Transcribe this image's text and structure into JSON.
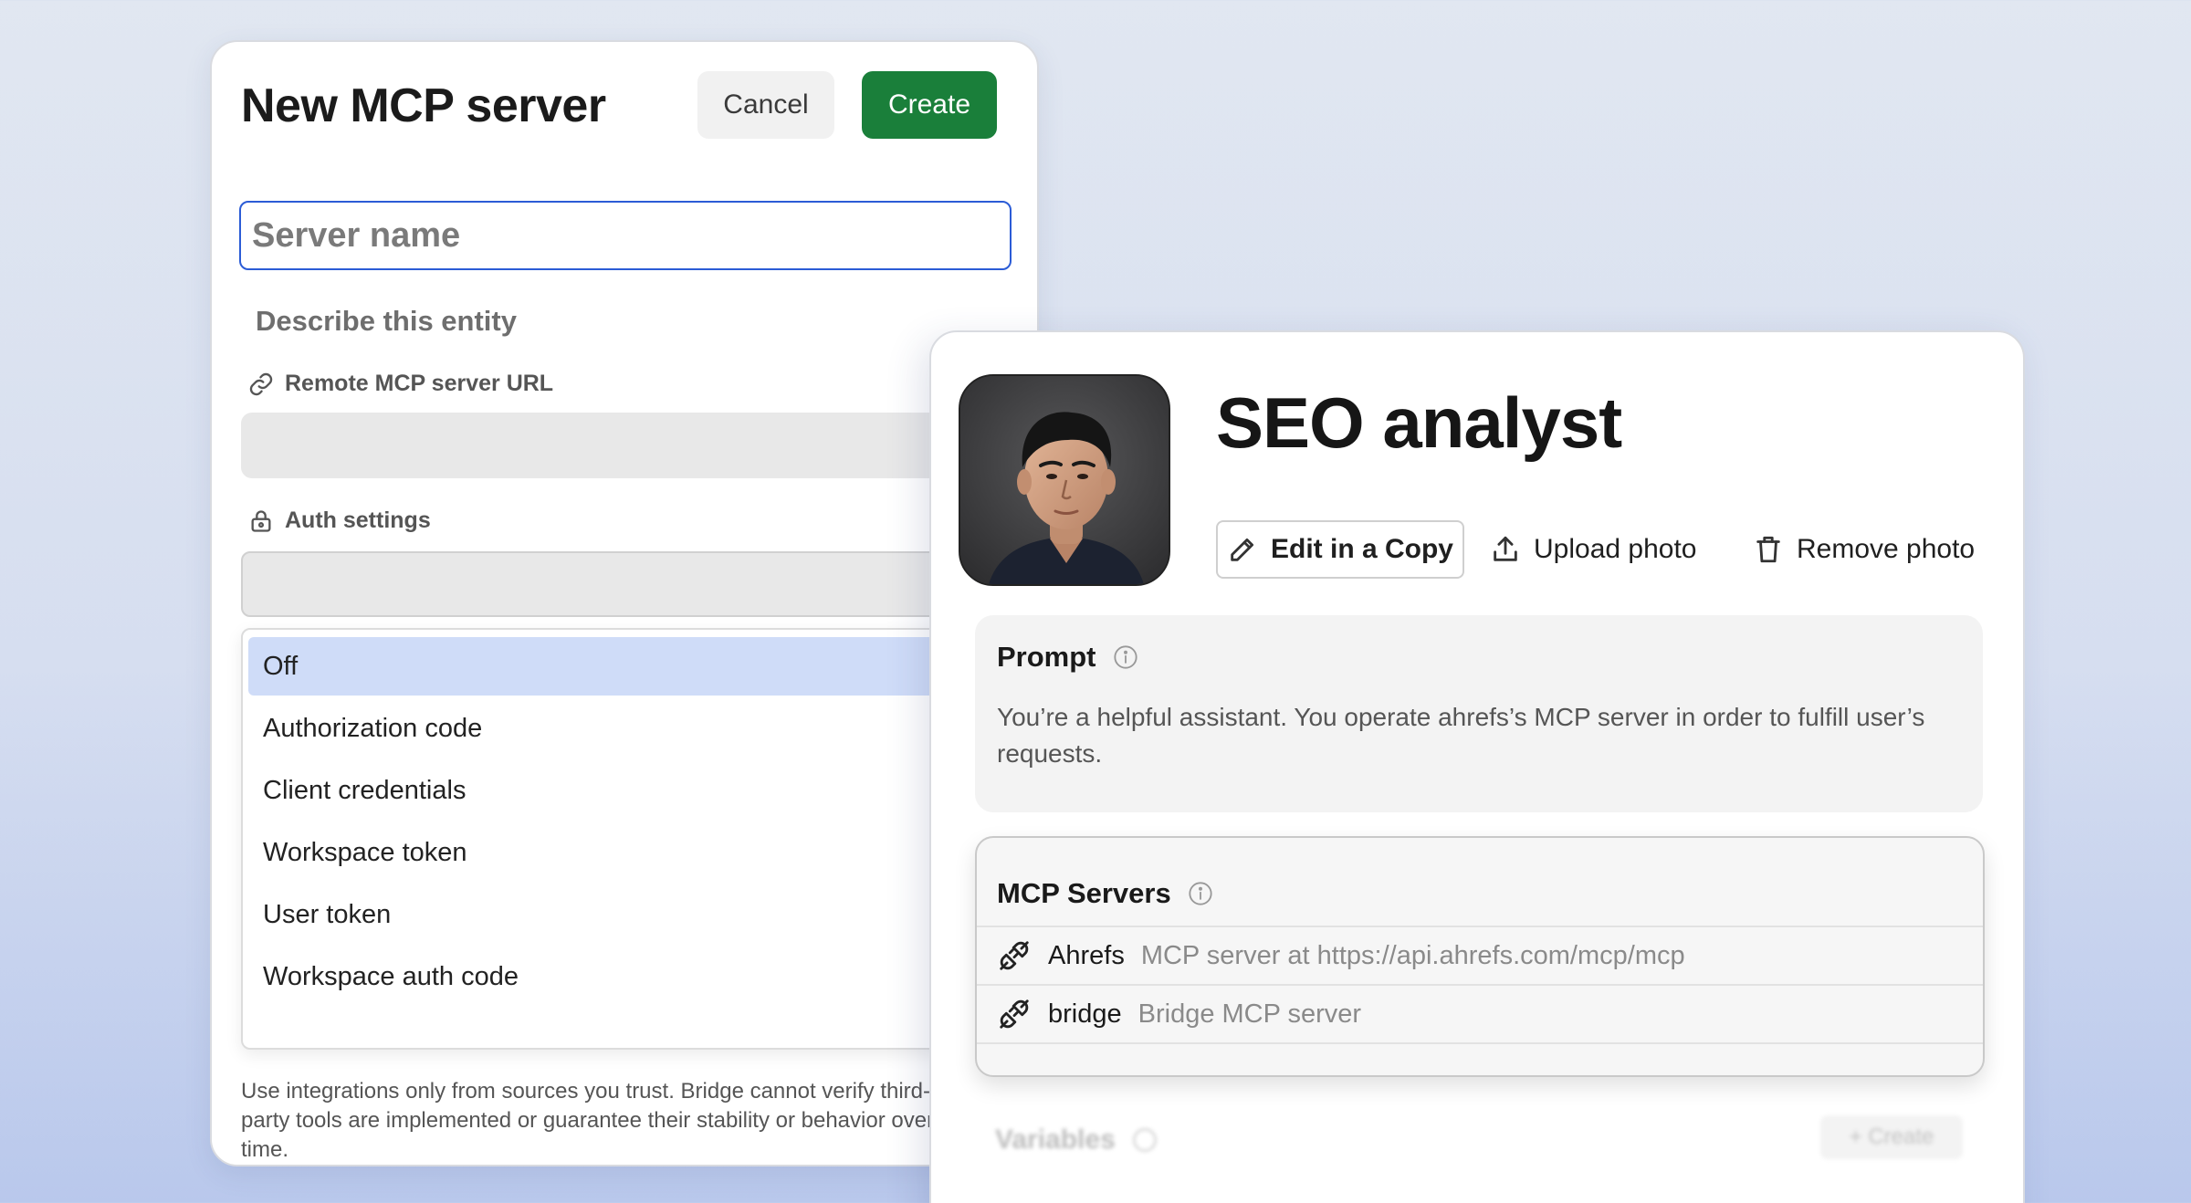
{
  "new_server": {
    "title": "New MCP server",
    "cancel_label": "Cancel",
    "create_label": "Create",
    "server_name_placeholder": "Server name",
    "describe_label": "Describe this entity",
    "url_label": "Remote MCP server URL",
    "auth_label": "Auth settings",
    "auth_options": [
      "Off",
      "Authorization code",
      "Client credentials",
      "Workspace token",
      "User token",
      "Workspace auth code"
    ],
    "auth_selected": "Off",
    "disclaimer": "Use integrations only from sources you trust. Bridge cannot verify third-party tools are implemented or guarantee their stability or behavior over time."
  },
  "agent": {
    "name": "SEO analyst",
    "edit_label": "Edit in a Copy",
    "upload_label": "Upload photo",
    "remove_label": "Remove photo",
    "prompt_heading": "Prompt",
    "prompt_text": "You’re a helpful assistant. You operate ahrefs’s MCP server in order to fulfill user’s requests.",
    "mcp_heading": "MCP Servers",
    "mcp_servers": [
      {
        "name": "Ahrefs",
        "description": "MCP server at https://api.ahrefs.com/mcp/mcp"
      },
      {
        "name": "bridge",
        "description": "Bridge MCP server"
      }
    ],
    "variables_heading": "Variables",
    "variables_create": "+ Create"
  },
  "icons": {
    "url": "link-icon",
    "auth": "lock-icon",
    "edit": "pencil-icon",
    "upload": "upload-icon",
    "remove": "trash-icon",
    "info": "info-icon",
    "server": "plug-icon"
  },
  "colors": {
    "primary": "#1a7f3a",
    "focus": "#2b5cd6",
    "selected": "#cfdcf8"
  }
}
